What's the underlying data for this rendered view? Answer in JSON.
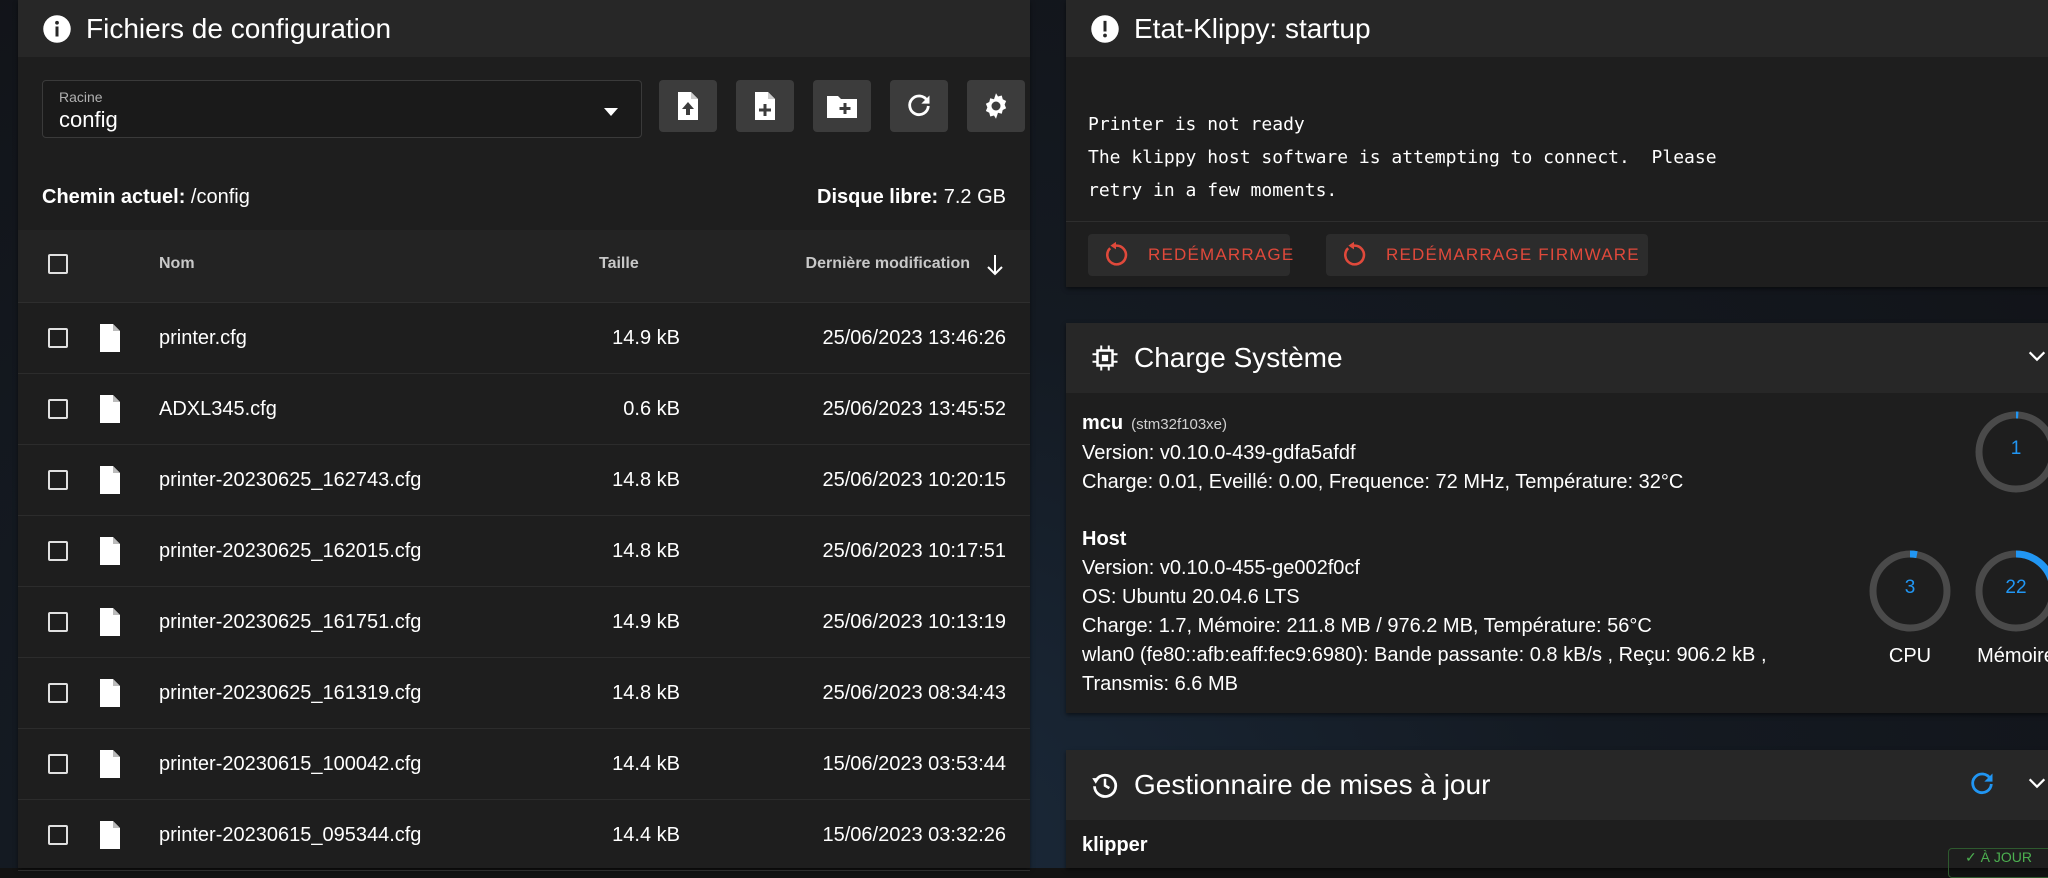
{
  "files": {
    "title": "Fichiers de configuration",
    "root_label": "Racine",
    "root_value": "config",
    "path_label": "Chemin actuel:",
    "path_value": "/config",
    "free_label": "Disque libre:",
    "free_value": "7.2 GB",
    "columns": {
      "name": "Nom",
      "size": "Taille",
      "modified": "Dernière modification"
    },
    "rows": [
      {
        "name": "printer.cfg",
        "size": "14.9 kB",
        "modified": "25/06/2023 13:46:26"
      },
      {
        "name": "ADXL345.cfg",
        "size": "0.6 kB",
        "modified": "25/06/2023 13:45:52"
      },
      {
        "name": "printer-20230625_162743.cfg",
        "size": "14.8 kB",
        "modified": "25/06/2023 10:20:15"
      },
      {
        "name": "printer-20230625_162015.cfg",
        "size": "14.8 kB",
        "modified": "25/06/2023 10:17:51"
      },
      {
        "name": "printer-20230625_161751.cfg",
        "size": "14.9 kB",
        "modified": "25/06/2023 10:13:19"
      },
      {
        "name": "printer-20230625_161319.cfg",
        "size": "14.8 kB",
        "modified": "25/06/2023 08:34:43"
      },
      {
        "name": "printer-20230615_100042.cfg",
        "size": "14.4 kB",
        "modified": "15/06/2023 03:53:44"
      },
      {
        "name": "printer-20230615_095344.cfg",
        "size": "14.4 kB",
        "modified": "15/06/2023 03:32:26"
      }
    ]
  },
  "klippy": {
    "title": "Etat-Klippy: startup",
    "console_lines": [
      "Printer is not ready",
      "The klippy host software is attempting to connect.  Please",
      "retry in a few moments."
    ],
    "restart_label": "REDÉMARRAGE",
    "firmware_restart_label": "REDÉMARRAGE FIRMWARE"
  },
  "system_load": {
    "title": "Charge Système",
    "mcu": {
      "title": "mcu",
      "chip": "(stm32f103xe)",
      "version": "Version: v0.10.0-439-gdfa5afdf",
      "load": "Charge: 0.01, Eveillé: 0.00, Frequence: 72 MHz, Température: 32°C",
      "gauge_value": "1"
    },
    "host": {
      "title": "Host",
      "version": "Version: v0.10.0-455-ge002f0cf",
      "os": "OS: Ubuntu 20.04.6 LTS",
      "load": "Charge: 1.7, Mémoire: 211.8 MB / 976.2 MB, Température: 56°C",
      "net": "wlan0 (fe80::afb:eaff:fec9:6980): Bande passante: 0.8 kB/s , Reçu: 906.2 kB ,",
      "net2": "Transmis: 6.6 MB",
      "cpu_value": "3",
      "cpu_label": "CPU",
      "mem_value": "22",
      "mem_label": "Mémoire"
    }
  },
  "updates": {
    "title": "Gestionnaire de mises à jour",
    "item": "klipper",
    "badge": "✓ À JOUR"
  },
  "colors": {
    "accent": "#2196f3",
    "danger": "#e0493b",
    "success": "#4caf50"
  }
}
